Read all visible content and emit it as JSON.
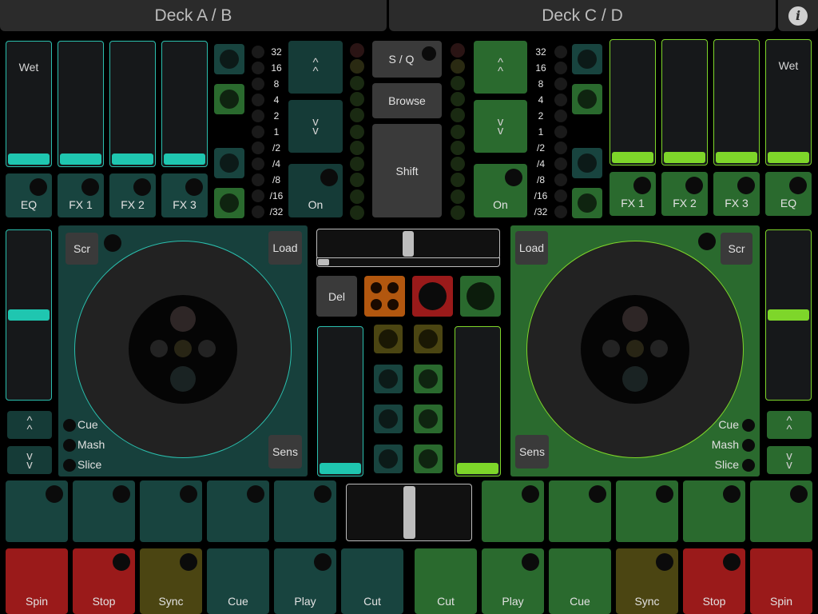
{
  "tabs": {
    "left": "Deck A / B",
    "right": "Deck C / D"
  },
  "info_icon": "info-icon",
  "left": {
    "fx_faders": [
      {
        "label": "Wet",
        "level": 0.05
      },
      {
        "label": "",
        "level": 0.05
      },
      {
        "label": "",
        "level": 0.05
      },
      {
        "label": "",
        "level": 0.05
      }
    ],
    "fx_buttons": [
      "EQ",
      "FX 1",
      "FX 2",
      "FX 3"
    ],
    "pitch_level": 0.52,
    "scr": "Scr",
    "load": "Load",
    "sens": "Sens",
    "modes": [
      "Cue",
      "Mash",
      "Slice"
    ],
    "on": "On",
    "bottom_row": [
      "Spin",
      "Stop",
      "Sync",
      "Cue",
      "Play",
      "Cut"
    ],
    "volume_level": 0.05
  },
  "right": {
    "fx_faders": [
      {
        "label": "",
        "level": 0.05
      },
      {
        "label": "",
        "level": 0.05
      },
      {
        "label": "",
        "level": 0.05
      },
      {
        "label": "Wet",
        "level": 0.05
      }
    ],
    "fx_buttons": [
      "FX 1",
      "FX 2",
      "FX 3",
      "EQ"
    ],
    "pitch_level": 0.52,
    "scr": "Scr",
    "load": "Load",
    "sens": "Sens",
    "modes": [
      "Cue",
      "Mash",
      "Slice"
    ],
    "on": "On",
    "bottom_row": [
      "Cut",
      "Play",
      "Cue",
      "Sync",
      "Stop",
      "Spin"
    ],
    "volume_level": 0.05
  },
  "beat_divisions": [
    "32",
    "16",
    "8",
    "4",
    "2",
    "1",
    "/2",
    "/4",
    "/8",
    "/16",
    "/32"
  ],
  "center": {
    "sq": "S / Q",
    "browse": "Browse",
    "shift": "Shift",
    "del": "Del"
  },
  "up_arrow": "^\n^",
  "down_arrow": "v\nv",
  "colors": {
    "teal": "#1fc6b0",
    "green": "#7ed62a",
    "red": "#9a1a1a",
    "olive": "#4b4512"
  }
}
